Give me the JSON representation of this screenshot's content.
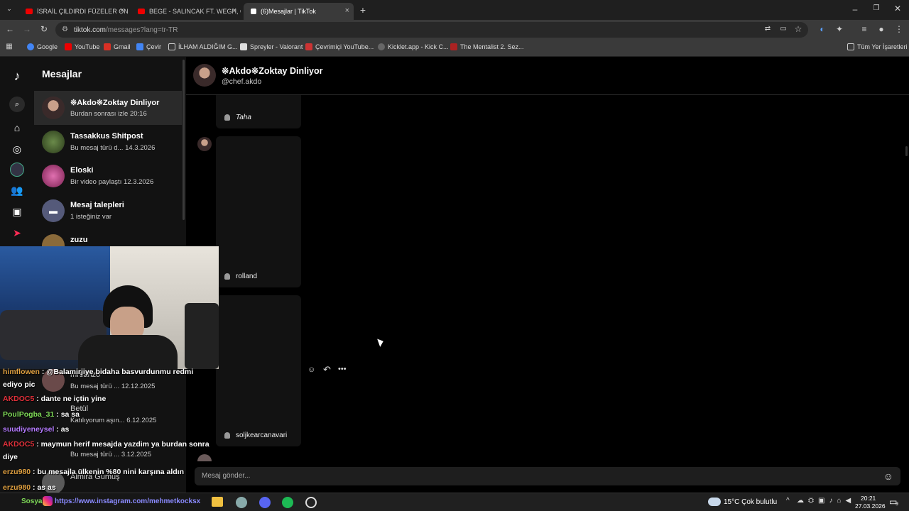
{
  "browser": {
    "tabs": [
      {
        "title": "İSRAİL ÇILDIRDI FÜZELER ONLİ...",
        "close": "×"
      },
      {
        "title": "BEGE - SALINCAK FT. WEGH, O...",
        "close": "×"
      },
      {
        "title": "(6)Mesajlar | TikTok",
        "close": "×"
      }
    ],
    "new_tab": "+",
    "url_host": "tiktok.com",
    "url_path": "/messages?lang=tr-TR",
    "bookmarks": [
      "Google",
      "YouTube",
      "Gmail",
      "Çevir",
      "İLHAM ALDIĞIM G...",
      "Spreyler - Valorant",
      "Çevrimiçi YouTube...",
      "Kicklet.app - Kick C...",
      "The Mentalist 2. Sez..."
    ],
    "bookmarks_all": "Tüm Yer İşaretleri"
  },
  "inbox": {
    "title": "Mesajlar",
    "conversations": [
      {
        "name": "※Akdo※Zoktay Dinliyor",
        "preview": "Burdan sonrası izle",
        "time": "20:16"
      },
      {
        "name": "Tassakkus Shitpost",
        "preview": "Bu mesaj türü d...",
        "time": "14.3.2026"
      },
      {
        "name": "Eloski",
        "preview": "Bir video paylaştı",
        "time": "12.3.2026"
      },
      {
        "name": "Mesaj talepleri",
        "preview": "1 isteğiniz var",
        "time": ""
      },
      {
        "name": "zuzu",
        "preview": "",
        "time": ""
      },
      {
        "name": "mrsanzo",
        "preview": "Bu mesaj türü ...",
        "time": "12.12.2025"
      },
      {
        "name": "Betül",
        "preview": "Katılıyorum aşın...",
        "time": "6.12.2025"
      },
      {
        "name": "",
        "preview": "Bu mesaj türü ...",
        "time": "3.12.2025"
      },
      {
        "name": "Almira Gumuş",
        "preview": "",
        "time": ""
      }
    ]
  },
  "chat": {
    "contact_name": "※Akdo※Zoktay Dinliyor",
    "contact_handle": "@chef.akdo",
    "shared_cards": [
      {
        "author": "Taha"
      },
      {
        "author": "rolland"
      },
      {
        "author": "soljkearcanavari"
      }
    ],
    "composer_placeholder": "Mesaj gönder..."
  },
  "stream_chat": [
    {
      "user": "himflowen",
      "text": " : @Balamirjiye bidaha basvurdunmu redmi",
      "color": "#e0a040"
    },
    {
      "user": "",
      "text": "ediyo pic",
      "color": "#ffffff"
    },
    {
      "user": "AKDOC5",
      "text": " : dante ne içtin yine",
      "color": "#e0303a"
    },
    {
      "user": "PoulPogba_31",
      "text": " : sa sa",
      "color": "#7ed957"
    },
    {
      "user": "suudiyeneysel",
      "text": " : as",
      "color": "#b57bff"
    },
    {
      "user": "AKDOC5",
      "text": " : maymun herif mesajda yazdim ya burdan sonra",
      "color": "#e0303a"
    },
    {
      "user": "",
      "text": "diye",
      "color": "#ffffff"
    },
    {
      "user": "erzu980",
      "text": " : bu mesajla ülkenin %80 nini karşına aldın",
      "color": "#e0a040"
    },
    {
      "user": "erzu980",
      "text": " : as as",
      "color": "#e0a040"
    }
  ],
  "stream_banner": {
    "label": "Sosyal",
    "link": "https://www.instagram.com/mehmetkocksx"
  },
  "taskbar": {
    "weather": "15°C  Çok bulutlu",
    "time": "20:21",
    "date": "27.03.2026",
    "notifications": "9"
  }
}
